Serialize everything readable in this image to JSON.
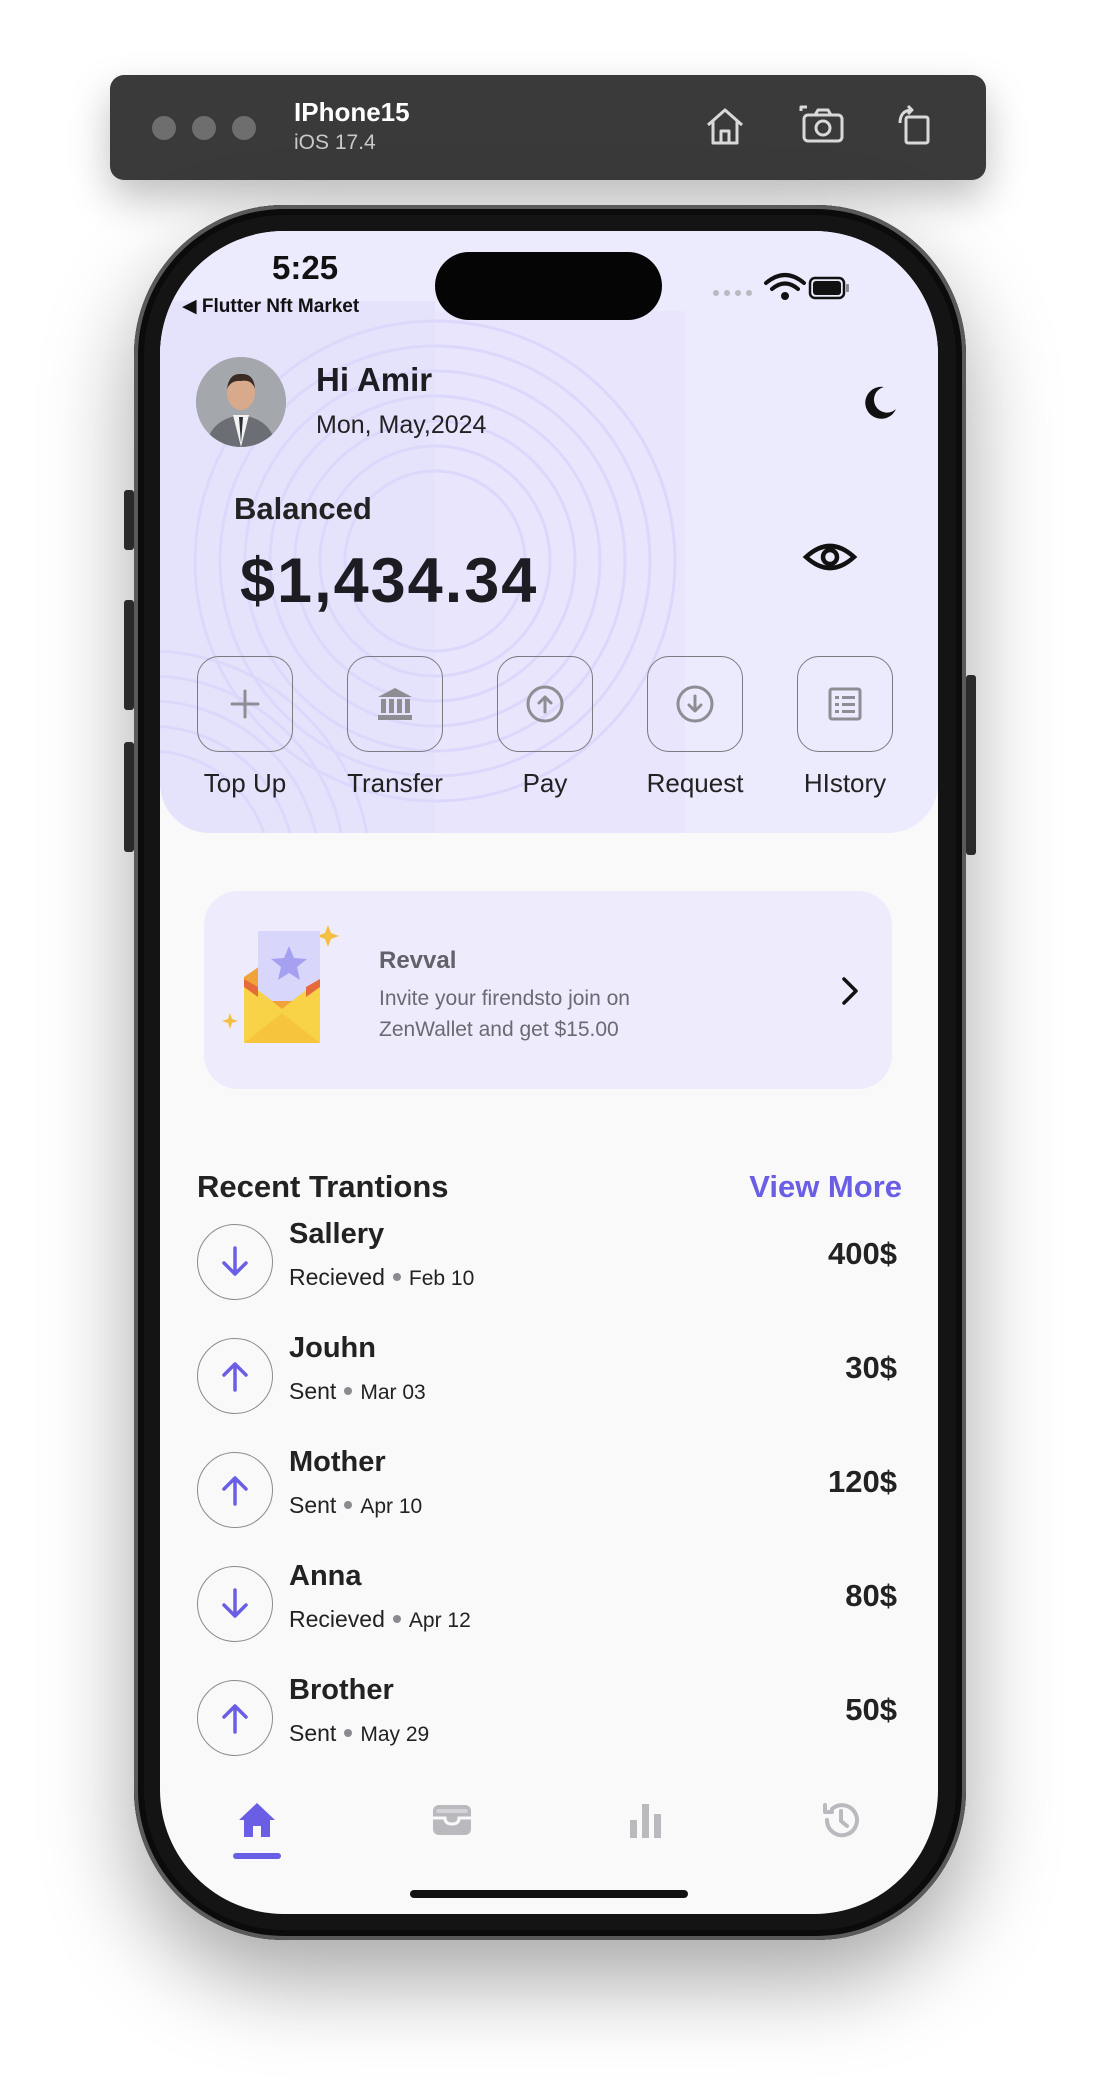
{
  "simulator": {
    "device_name": "IPhone15",
    "os_version": "iOS 17.4",
    "buttons": [
      "home-icon",
      "screenshot-icon",
      "rotate-icon"
    ]
  },
  "status_bar": {
    "time": "5:25",
    "back_app": "◀ Flutter Nft Market"
  },
  "header": {
    "greeting": "Hi Amir",
    "date": "Mon, May,2024",
    "theme_icon": "moon-icon"
  },
  "balance": {
    "label": "Balanced",
    "amount": "$1,434.34",
    "visibility_icon": "eye-icon"
  },
  "actions": [
    {
      "label": "Top Up",
      "icon": "plus-icon"
    },
    {
      "label": "Transfer",
      "icon": "bank-icon"
    },
    {
      "label": "Pay",
      "icon": "upload-circle-icon"
    },
    {
      "label": "Request",
      "icon": "download-circle-icon"
    },
    {
      "label": "HIstory",
      "icon": "list-icon"
    }
  ],
  "promo": {
    "title": "Revval",
    "text": "Invite your firendsto join on\n ZenWallet and get $15.00",
    "icon": "envelope-star-icon"
  },
  "recent": {
    "title": "Recent Trantions",
    "view_more": "View More",
    "items": [
      {
        "name": "Sallery",
        "type": "Recieved",
        "date": "Feb 10",
        "amount": "400$",
        "direction": "in"
      },
      {
        "name": "Jouhn",
        "type": "Sent",
        "date": "Mar 03",
        "amount": "30$",
        "direction": "out"
      },
      {
        "name": "Mother",
        "type": "Sent",
        "date": "Apr 10",
        "amount": "120$",
        "direction": "out"
      },
      {
        "name": "Anna",
        "type": "Recieved",
        "date": "Apr 12",
        "amount": "80$",
        "direction": "in"
      },
      {
        "name": "Brother",
        "type": "Sent",
        "date": "May 29",
        "amount": "50$",
        "direction": "out"
      }
    ]
  },
  "bottom_nav": {
    "items": [
      "home-icon",
      "wallet-icon",
      "stats-icon",
      "history-icon"
    ],
    "active": "home-icon"
  },
  "colors": {
    "accent": "#6a5ee4",
    "hero_bg": "#eceafd",
    "promo_bg": "#edebfc",
    "screen_bg": "#f9f9f9",
    "text": "#1c1c22"
  }
}
